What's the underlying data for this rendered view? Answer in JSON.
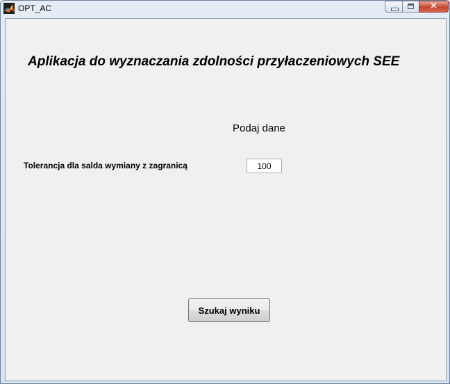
{
  "window": {
    "title": "OPT_AC",
    "icon": "matlab-icon",
    "close_symbol": "✕"
  },
  "main": {
    "heading": "Aplikacja do wyznaczania zdolności przyłaczeniowych SEE",
    "subheading": "Podaj dane",
    "tolerance_label": "Tolerancja dla salda wymiany z zagranicą",
    "tolerance_value": "100",
    "search_button_label": "Szukaj wyniku"
  }
}
